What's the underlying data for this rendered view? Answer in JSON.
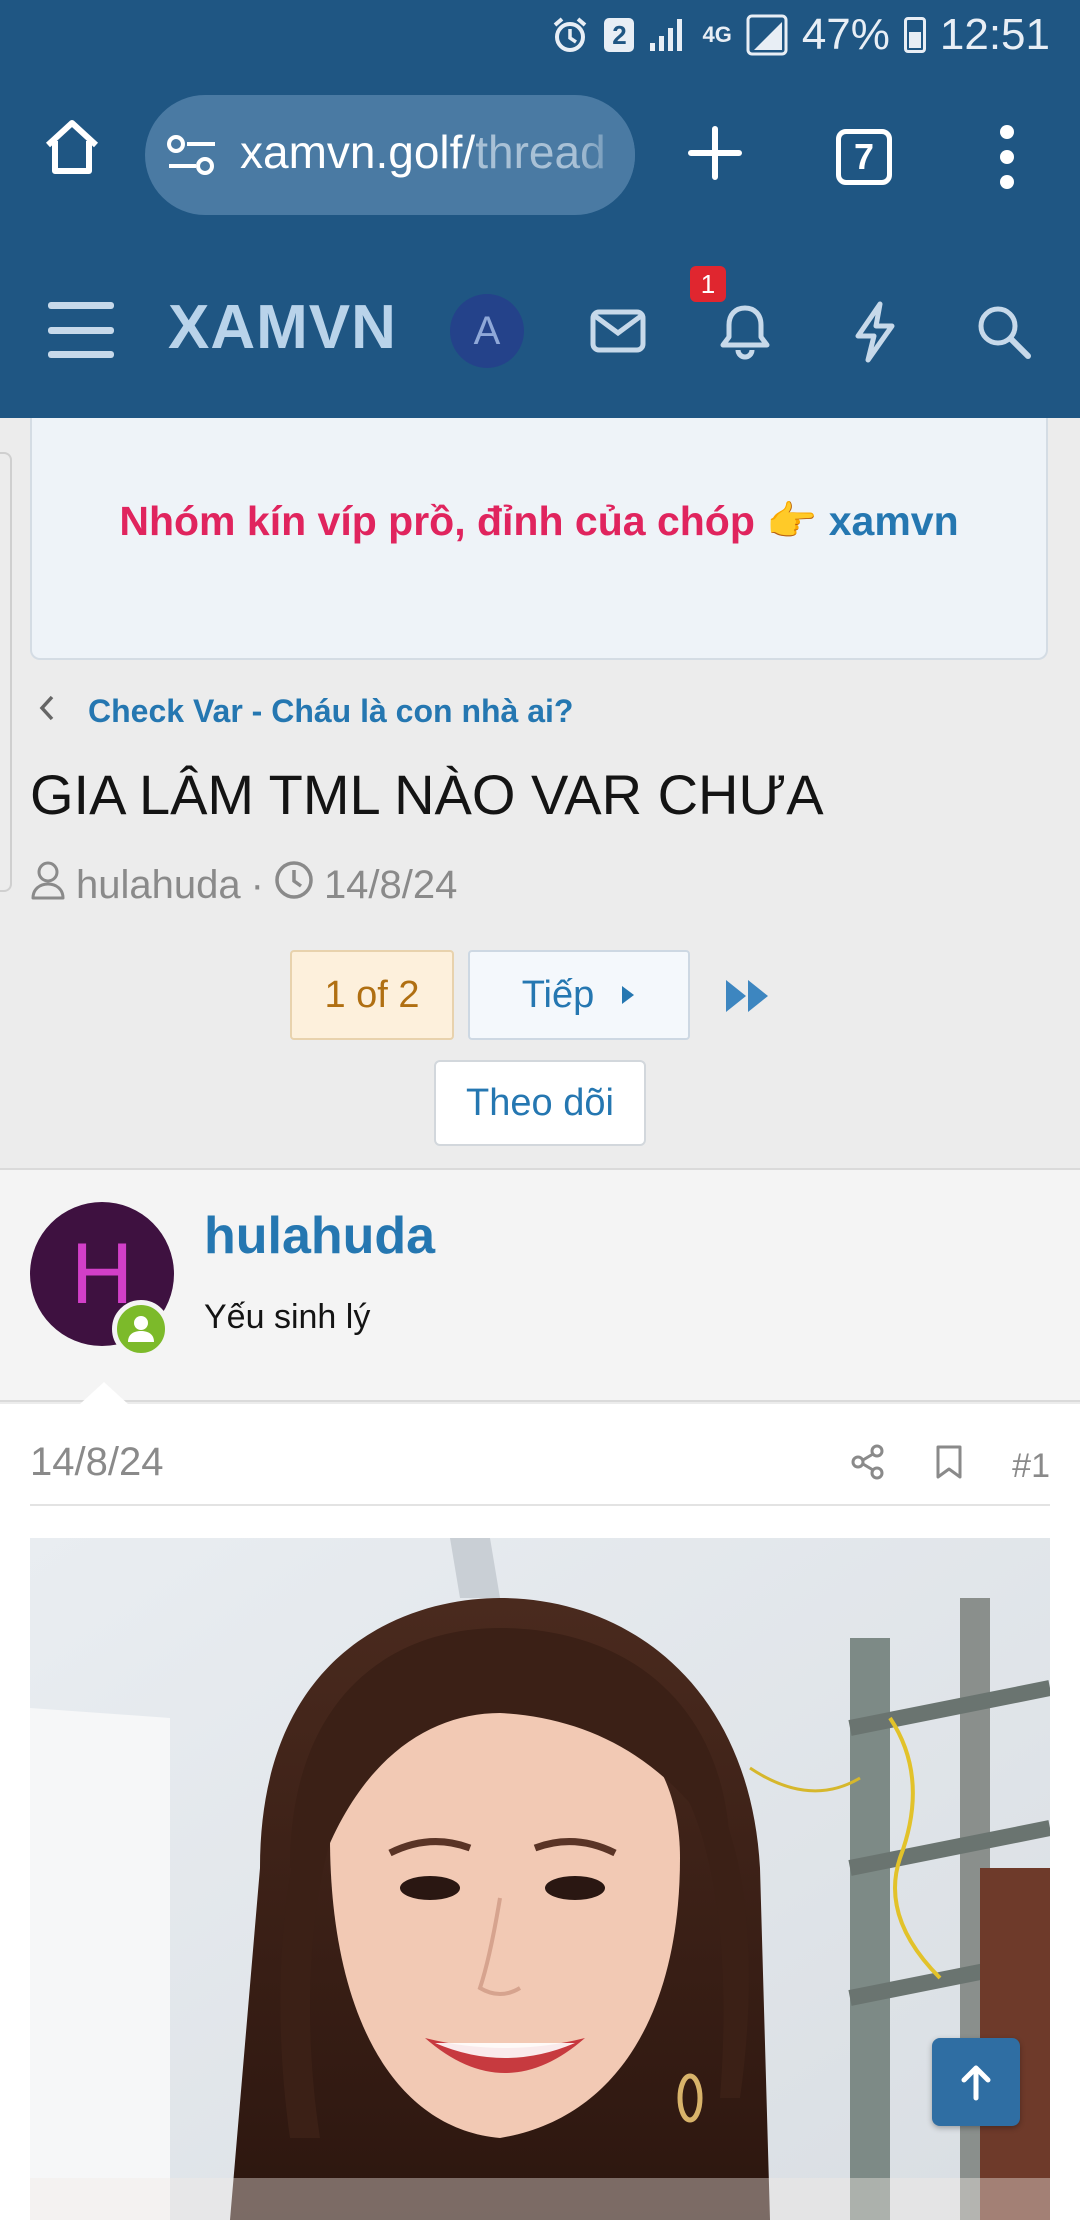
{
  "status_bar": {
    "sim_badge": "2",
    "network": "4G",
    "battery": "47%",
    "time": "12:51"
  },
  "browser": {
    "url": "xamvn.golf/",
    "url_rest": "thread",
    "tab_count": "7"
  },
  "site_nav": {
    "logo": "XAMVN",
    "avatar_letter": "A",
    "notification_count": "1"
  },
  "promo": {
    "text": "Nhóm kín víp prồ, đỉnh của chóp 👉 ",
    "link": "xamvn"
  },
  "breadcrumb": {
    "label": "Check Var - Cháu là con nhà ai?"
  },
  "thread": {
    "title": "GIA LÂM TML NÀO VAR CHƯA",
    "author": "hulahuda",
    "separator": "·",
    "date": "14/8/24"
  },
  "pagination": {
    "current": "1 of 2",
    "next_label": "Tiếp"
  },
  "follow_label": "Theo dõi",
  "post": {
    "avatar_letter": "H",
    "username": "hulahuda",
    "user_title": "Yếu sinh lý",
    "date": "14/8/24",
    "number": "#1"
  },
  "colors": {
    "header_bg": "#1f5683",
    "link": "#2577b1",
    "promo_pink": "#e0245e",
    "online": "#7cba2a"
  }
}
